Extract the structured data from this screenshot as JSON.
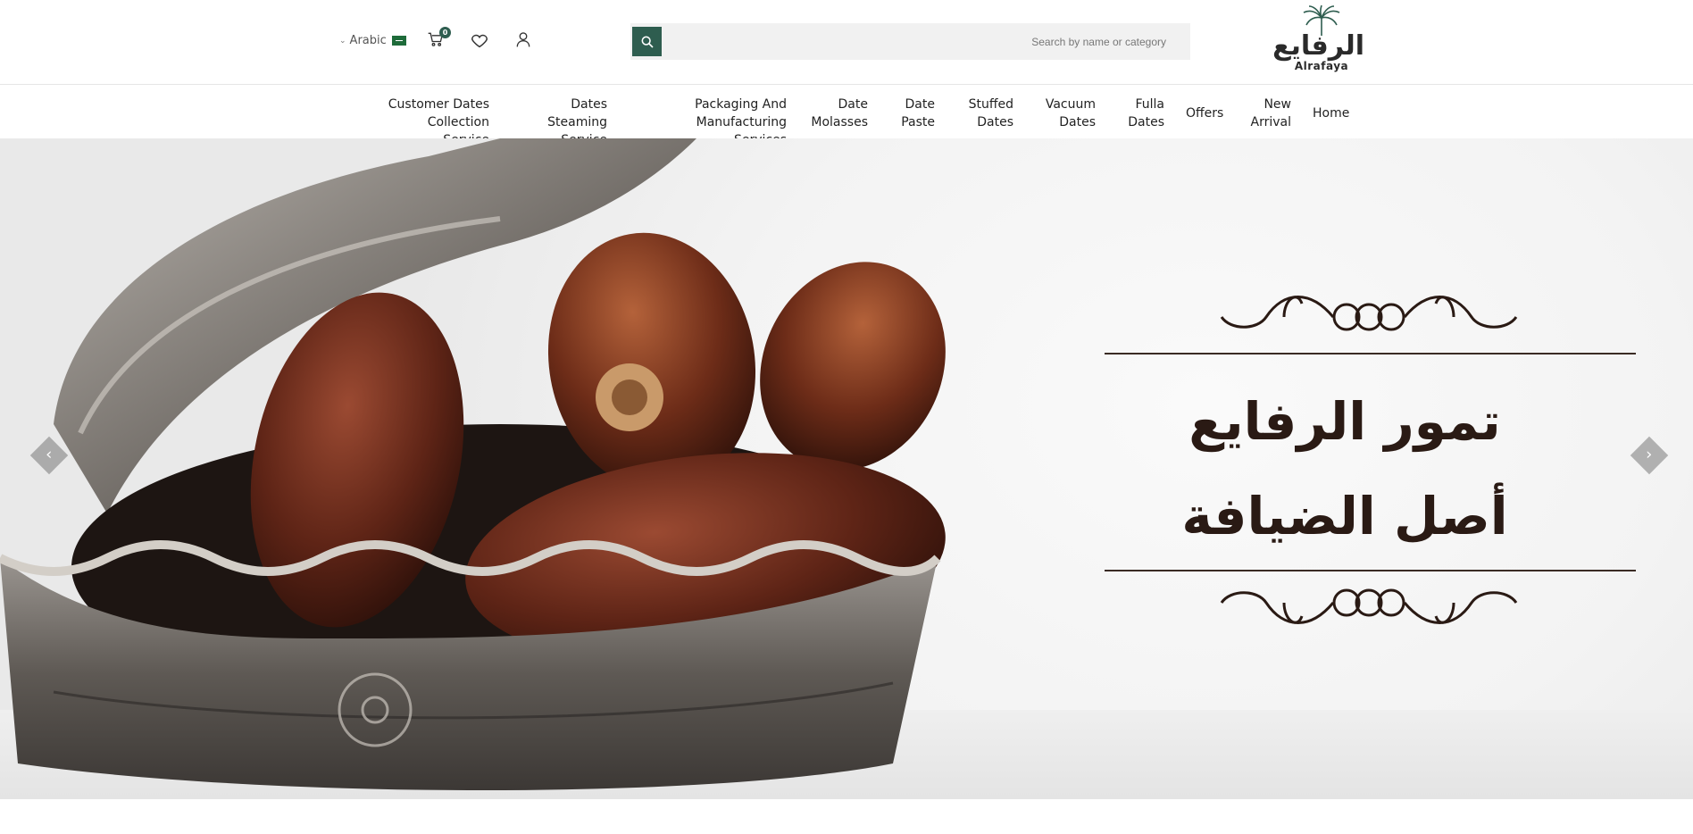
{
  "header": {
    "language_label": "Arabic",
    "cart_count": "0",
    "search_placeholder": "Search by name or category",
    "logo_arabic": "الرفايع",
    "logo_english": "Alrafaya"
  },
  "nav": {
    "items": [
      {
        "label": "Customer Dates Collection Service"
      },
      {
        "label": "Dates Steaming Service"
      },
      {
        "label": "Packaging And Manufacturing Services"
      },
      {
        "label": "Date Molasses"
      },
      {
        "label": "Date Paste"
      },
      {
        "label": "Stuffed Dates"
      },
      {
        "label": "Vacuum Dates"
      },
      {
        "label": "Fulla Dates"
      },
      {
        "label": "Offers"
      },
      {
        "label": "New Arrival"
      },
      {
        "label": "Home"
      }
    ]
  },
  "hero": {
    "line1": "تمور الرفايع",
    "line2": "أصل الضيافة",
    "prev_arrow": "‹",
    "next_arrow": "›"
  },
  "colors": {
    "brand": "#2e5d4f",
    "text_dark": "#2a1a14"
  }
}
